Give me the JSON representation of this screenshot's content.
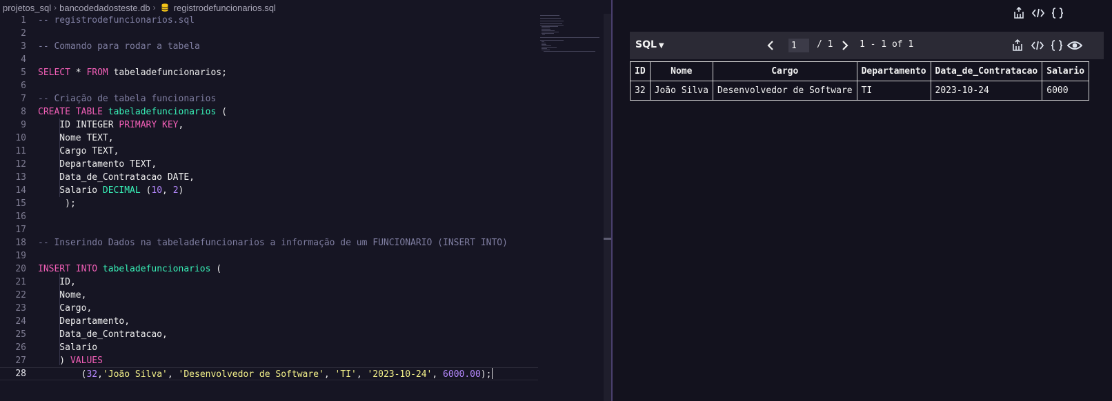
{
  "breadcrumb": {
    "items": [
      "projetos_sql",
      "bancodedadosteste.db",
      "registrodefuncionarios.sql"
    ]
  },
  "editor": {
    "lines": [
      {
        "n": "1",
        "tokens": [
          [
            "c-com",
            "-- registrodefuncionarios.sql"
          ]
        ]
      },
      {
        "n": "2",
        "tokens": []
      },
      {
        "n": "3",
        "tokens": [
          [
            "c-com",
            "-- Comando para rodar a tabela"
          ]
        ]
      },
      {
        "n": "4",
        "tokens": []
      },
      {
        "n": "5",
        "tokens": [
          [
            "c-kw",
            "SELECT"
          ],
          [
            "c-txt",
            " * "
          ],
          [
            "c-kw",
            "FROM"
          ],
          [
            "c-txt",
            " tabeladefuncionarios;"
          ]
        ]
      },
      {
        "n": "6",
        "tokens": []
      },
      {
        "n": "7",
        "tokens": [
          [
            "c-com",
            "-- Criação de tabela funcionarios"
          ]
        ]
      },
      {
        "n": "8",
        "tokens": [
          [
            "c-kw",
            "CREATE TABLE"
          ],
          [
            "c-txt",
            " "
          ],
          [
            "c-id",
            "tabeladefuncionarios"
          ],
          [
            "c-txt",
            " ("
          ]
        ]
      },
      {
        "n": "9",
        "tokens": [
          [
            "c-txt",
            "    ID INTEGER "
          ],
          [
            "c-kw",
            "PRIMARY KEY"
          ],
          [
            "c-txt",
            ","
          ]
        ]
      },
      {
        "n": "10",
        "tokens": [
          [
            "c-txt",
            "    Nome TEXT,"
          ]
        ]
      },
      {
        "n": "11",
        "tokens": [
          [
            "c-txt",
            "    Cargo TEXT,"
          ]
        ]
      },
      {
        "n": "12",
        "tokens": [
          [
            "c-txt",
            "    Departamento TEXT,"
          ]
        ]
      },
      {
        "n": "13",
        "tokens": [
          [
            "c-txt",
            "    Data_de_Contratacao DATE,"
          ]
        ]
      },
      {
        "n": "14",
        "tokens": [
          [
            "c-txt",
            "    Salario "
          ],
          [
            "c-id",
            "DECIMAL"
          ],
          [
            "c-txt",
            " ("
          ],
          [
            "c-num",
            "10"
          ],
          [
            "c-txt",
            ", "
          ],
          [
            "c-num",
            "2"
          ],
          [
            "c-txt",
            ")"
          ]
        ]
      },
      {
        "n": "15",
        "tokens": [
          [
            "c-txt",
            "     );"
          ]
        ]
      },
      {
        "n": "16",
        "tokens": []
      },
      {
        "n": "17",
        "tokens": []
      },
      {
        "n": "18",
        "tokens": [
          [
            "c-com",
            "-- Inserindo Dados na tabeladefuncionarios a informação de um FUNCIONARIO (INSERT INTO)"
          ]
        ]
      },
      {
        "n": "19",
        "tokens": []
      },
      {
        "n": "20",
        "tokens": [
          [
            "c-kw",
            "INSERT INTO"
          ],
          [
            "c-txt",
            " "
          ],
          [
            "c-id",
            "tabeladefuncionarios"
          ],
          [
            "c-txt",
            " ("
          ]
        ]
      },
      {
        "n": "21",
        "tokens": [
          [
            "c-txt",
            "    ID,"
          ]
        ]
      },
      {
        "n": "22",
        "tokens": [
          [
            "c-txt",
            "    Nome,"
          ]
        ]
      },
      {
        "n": "23",
        "tokens": [
          [
            "c-txt",
            "    Cargo,"
          ]
        ]
      },
      {
        "n": "24",
        "tokens": [
          [
            "c-txt",
            "    Departamento,"
          ]
        ]
      },
      {
        "n": "25",
        "tokens": [
          [
            "c-txt",
            "    Data_de_Contratacao,"
          ]
        ]
      },
      {
        "n": "26",
        "tokens": [
          [
            "c-txt",
            "    Salario"
          ]
        ]
      },
      {
        "n": "27",
        "tokens": [
          [
            "c-txt",
            "    ) "
          ],
          [
            "c-kw",
            "VALUES"
          ]
        ]
      },
      {
        "n": "28",
        "tokens": [
          [
            "c-txt",
            "        ("
          ],
          [
            "c-num",
            "32"
          ],
          [
            "c-txt",
            ","
          ],
          [
            "c-str",
            "'João Silva'"
          ],
          [
            "c-txt",
            ", "
          ],
          [
            "c-str",
            "'Desenvolvedor de Software'"
          ],
          [
            "c-txt",
            ", "
          ],
          [
            "c-str",
            "'TI'"
          ],
          [
            "c-txt",
            ", "
          ],
          [
            "c-str",
            "'2023-10-24'"
          ],
          [
            "c-txt",
            ", "
          ],
          [
            "c-num",
            "6000.00"
          ],
          [
            "c-txt",
            ");"
          ]
        ]
      }
    ],
    "active_line": "28"
  },
  "results": {
    "toolbar": {
      "language_label": "SQL",
      "page_input_value": "1",
      "page_total": "/ 1",
      "range_text": "1 - 1 of 1"
    },
    "table": {
      "columns": [
        "ID",
        "Nome",
        "Cargo",
        "Departamento",
        "Data_de_Contratacao",
        "Salario"
      ],
      "rows": [
        [
          "32",
          "João Silva",
          "Desenvolvedor de Software",
          "TI",
          "2023-10-24",
          "6000"
        ]
      ]
    }
  },
  "colors": {
    "background": "#13121e",
    "comment": "#7f7ea1",
    "keyword": "#f25fb7",
    "identifier": "#38f2b8",
    "number": "#b689ff",
    "string": "#f3f08a"
  },
  "icons": {
    "db_file": "database-icon",
    "export": "export-icon",
    "code": "code-icon",
    "json": "json-braces-icon",
    "eye": "eye-icon"
  }
}
